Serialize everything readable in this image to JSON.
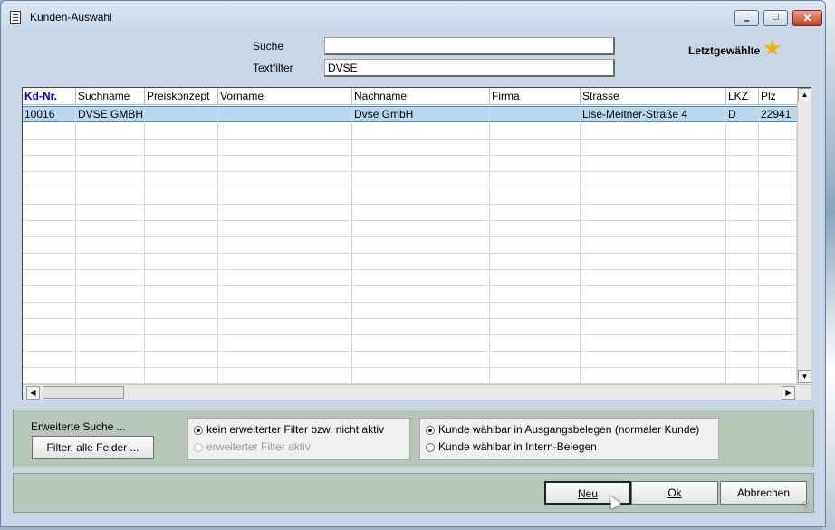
{
  "window": {
    "title": "Kunden-Auswahl"
  },
  "controls": {
    "min": "–",
    "max": "□",
    "close": "✕"
  },
  "search": {
    "suche_label": "Suche",
    "suche_value": "",
    "textfilter_label": "Textfilter",
    "textfilter_value": "DVSE"
  },
  "favorites": {
    "label": "Letztgewählte",
    "icon": "star-icon"
  },
  "table": {
    "columns": [
      "Kd-Nr.",
      "Suchname",
      "Preiskonzept",
      "Vorname",
      "Nachname",
      "Firma",
      "Strasse",
      "LKZ",
      "Plz"
    ],
    "rows": [
      [
        "10016",
        "DVSE GMBH",
        "",
        "",
        "Dvse GmbH",
        "",
        "Lise-Meitner-Straße 4",
        "D",
        "22941"
      ]
    ]
  },
  "scroll": {
    "up": "▲",
    "down": "▼",
    "left": "◀",
    "right": "▶"
  },
  "filter_panel": {
    "erweiterte_label": "Erweiterte Suche ...",
    "filter_button": "Filter, alle Felder ...",
    "filter_options": [
      {
        "label": "kein erweiterter Filter bzw. nicht aktiv",
        "checked": true,
        "disabled": false
      },
      {
        "label": "erweiterter Filter aktiv",
        "checked": false,
        "disabled": true
      }
    ],
    "customer_options": [
      {
        "label": "Kunde wählbar in Ausgangsbelegen (normaler Kunde)",
        "checked": true
      },
      {
        "label": "Kunde wählbar in Intern-Belegen",
        "checked": false
      }
    ]
  },
  "actions": {
    "neu": "Neu",
    "ok": "Ok",
    "abbrechen": "Abbrechen"
  }
}
